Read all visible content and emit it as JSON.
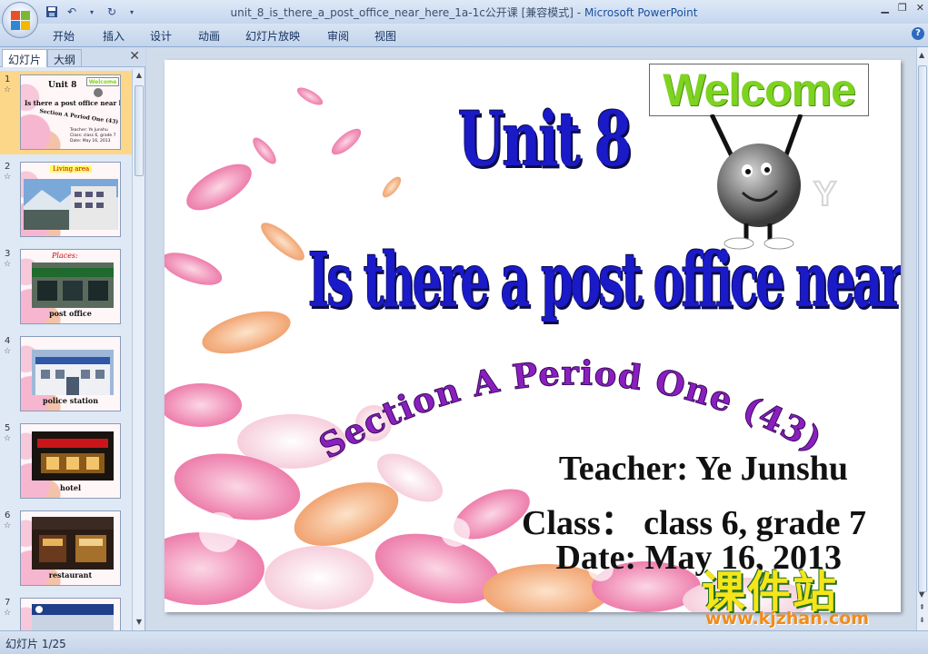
{
  "window": {
    "title": "unit_8_is_there_a_post_office_near_here_1a-1c公开课 [兼容模式] - ",
    "app_name": "Microsoft PowerPoint"
  },
  "ribbon": {
    "tabs": [
      "开始",
      "插入",
      "设计",
      "动画",
      "幻灯片放映",
      "审阅",
      "视图"
    ]
  },
  "panel": {
    "tab_slides": "幻灯片",
    "tab_outline": "大纲"
  },
  "thumbnails": [
    {
      "num": "1",
      "caption": "",
      "lines": [
        "Unit 8",
        "Is there a post office near here?",
        "Section A Period One (43)",
        "Teacher: Ye Junshu",
        "Class: class 6, grade 7",
        "Date: May 16, 2013"
      ],
      "welcome": "Welcome"
    },
    {
      "num": "2",
      "caption": "Living area"
    },
    {
      "num": "3",
      "caption": "post office",
      "header": "Places:"
    },
    {
      "num": "4",
      "caption": "police station"
    },
    {
      "num": "5",
      "caption": "hotel"
    },
    {
      "num": "6",
      "caption": "restaurant"
    },
    {
      "num": "7",
      "caption": ""
    }
  ],
  "slide": {
    "unit": "Unit 8",
    "title": "Is there a post office near here?",
    "subtitle": "Section A Period One (43)",
    "welcome": "Welcome",
    "teacher": "Teacher: Ye Junshu",
    "class": "Class： class 6, grade 7",
    "date": "Date: May 16, 2013"
  },
  "status": {
    "slide_counter": "幻灯片 1/25"
  },
  "watermark": {
    "cn": "课件站",
    "url": "www.kjzhan.com"
  },
  "colors": {
    "title_blue": "#1a1ac8",
    "subtitle_purple": "#8a1fbf",
    "welcome_green": "#7ed321",
    "active_thumb": "#fcd789"
  }
}
